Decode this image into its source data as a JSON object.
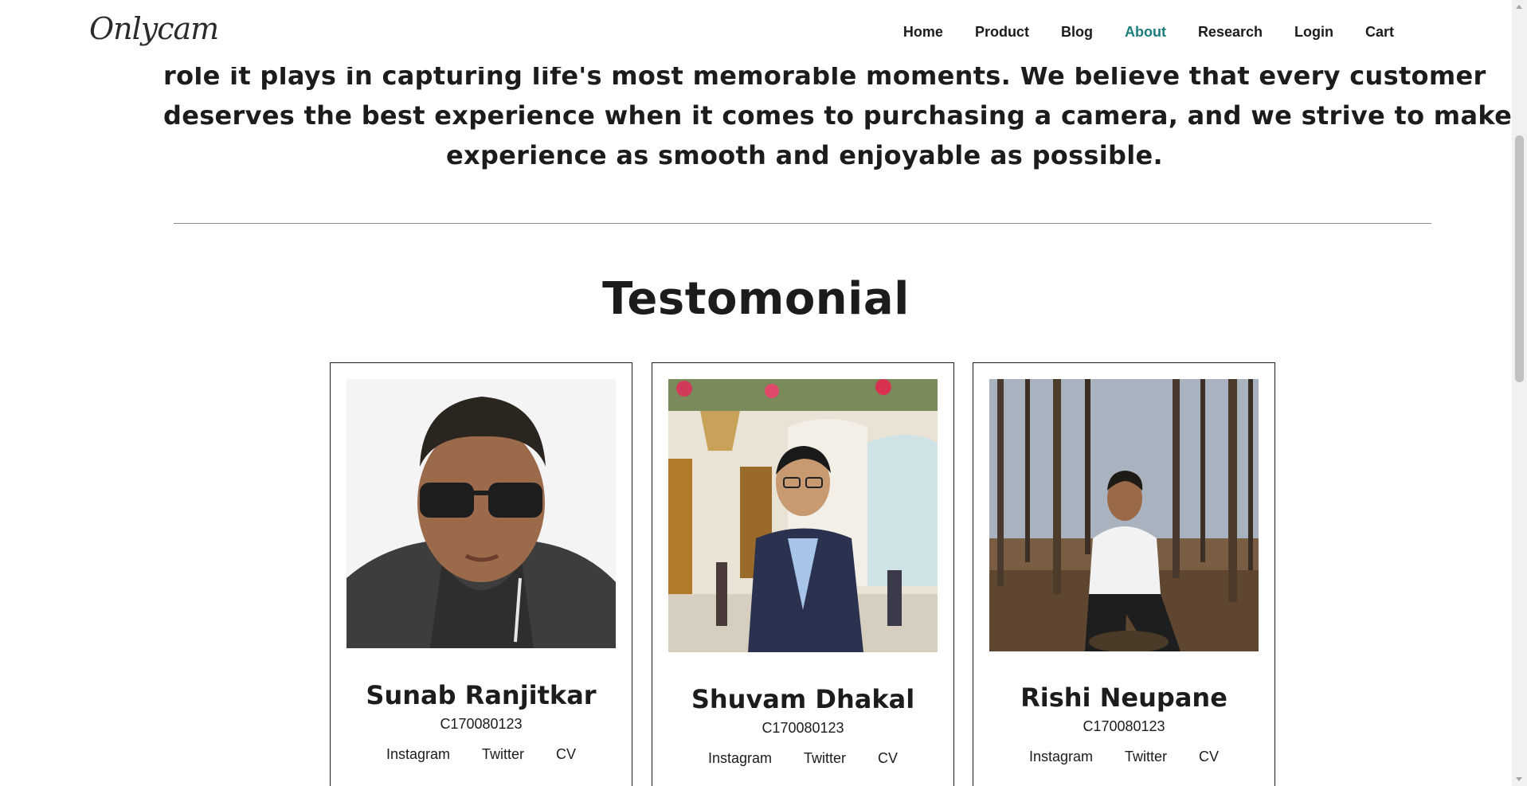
{
  "header": {
    "logo": "Onlycam",
    "nav": [
      {
        "label": "Home",
        "active": false
      },
      {
        "label": "Product",
        "active": false
      },
      {
        "label": "Blog",
        "active": false
      },
      {
        "label": "About",
        "active": true
      },
      {
        "label": "Research",
        "active": false
      },
      {
        "label": "Login",
        "active": false
      },
      {
        "label": "Cart",
        "active": false
      }
    ],
    "active_color": "#1b7c7c"
  },
  "intro": {
    "lines": [
      "role it plays in capturing life's most memorable moments. We believe that every customer",
      "deserves the best experience when it comes to purchasing a camera, and we strive to make that",
      "experience as smooth and enjoyable as possible."
    ]
  },
  "testimonials": {
    "title": "Testomonial",
    "cards": [
      {
        "name": "Sunab Ranjitkar",
        "id": "C170080123",
        "links": [
          "Instagram",
          "Twitter",
          "CV"
        ],
        "photo": "man-with-sunglasses-selfie"
      },
      {
        "name": "Shuvam Dhakal",
        "id": "C170080123",
        "links": [
          "Instagram",
          "Twitter",
          "CV"
        ],
        "photo": "man-in-suit-in-hall"
      },
      {
        "name": "Rishi Neupane",
        "id": "C170080123",
        "links": [
          "Instagram",
          "Twitter",
          "CV"
        ],
        "photo": "man-sitting-in-forest"
      }
    ]
  }
}
